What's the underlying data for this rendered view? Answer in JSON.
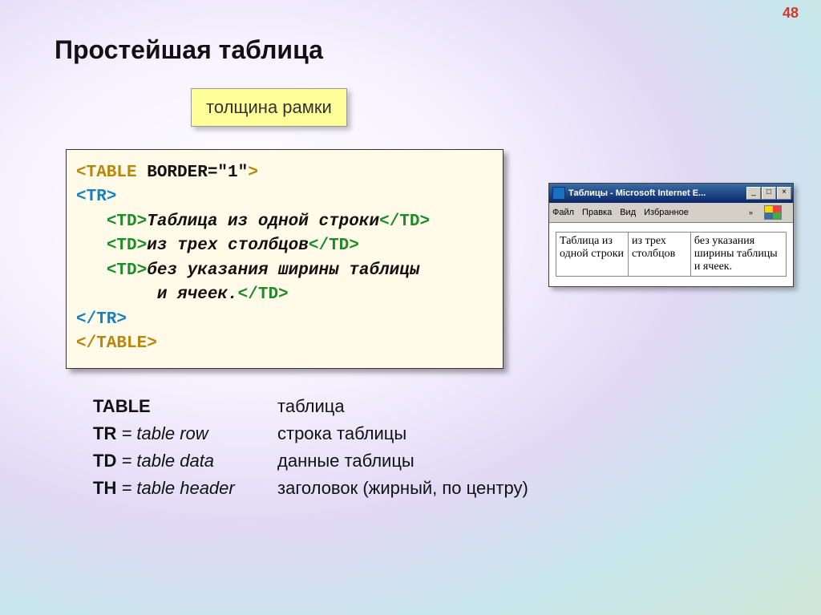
{
  "page_number": "48",
  "title": "Простейшая таблица",
  "callout": "толщина рамки",
  "code": {
    "openTable1": "<TABLE ",
    "openAttr": "BORDER=\"1\"",
    "openTable2": ">",
    "openTR": "<TR>",
    "td1": "Таблица из одной строки",
    "td2": "из трех столбцов",
    "td3a": "без указания ширины таблицы",
    "td3b": "        и ячеек.",
    "closeTR": "</TR>",
    "closeTable": "</TABLE>",
    "tdOpen": "<TD>",
    "tdClose": "</TD>"
  },
  "browser": {
    "title": "Таблицы - Microsoft Internet E...",
    "menu": [
      "Файл",
      "Правка",
      "Вид",
      "Избранное"
    ],
    "chev": "»",
    "btn_min": "_",
    "btn_max": "□",
    "btn_close": "×",
    "cells": [
      "Таблица из одной строки",
      "из трех столбцов",
      "без указания ширины таблицы и ячеек."
    ]
  },
  "defs": [
    {
      "tag": "TABLE",
      "en": "",
      "ru": "таблица"
    },
    {
      "tag": "TR",
      "en": " = table row",
      "ru": "строка таблицы"
    },
    {
      "tag": "TD",
      "en": " = table data",
      "ru": "данные таблицы"
    },
    {
      "tag": "TH",
      "en": " = table header",
      "ru": "заголовок (жирный, по центру)"
    }
  ]
}
